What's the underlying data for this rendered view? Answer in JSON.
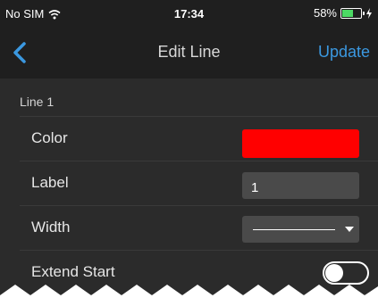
{
  "status_bar": {
    "carrier": "No SIM",
    "time": "17:34",
    "battery_percent": "58%",
    "battery_level": 0.58,
    "icons": [
      "wifi-icon",
      "battery-icon",
      "charging-bolt-icon"
    ]
  },
  "nav": {
    "back_icon": "chevron-left-icon",
    "title": "Edit Line",
    "update_label": "Update"
  },
  "section": {
    "header": "Line 1"
  },
  "rows": {
    "color": {
      "label": "Color",
      "value_color": "#ff0000"
    },
    "label": {
      "label": "Label",
      "value": "1"
    },
    "width": {
      "label": "Width"
    },
    "extend_start": {
      "label": "Extend Start",
      "on": false
    }
  },
  "colors": {
    "accent": "#3b98e0",
    "background": "#2b2b2b",
    "bar_background": "#1f1f1f",
    "field_background": "#4a4a4a",
    "battery_green": "#4cd964"
  }
}
